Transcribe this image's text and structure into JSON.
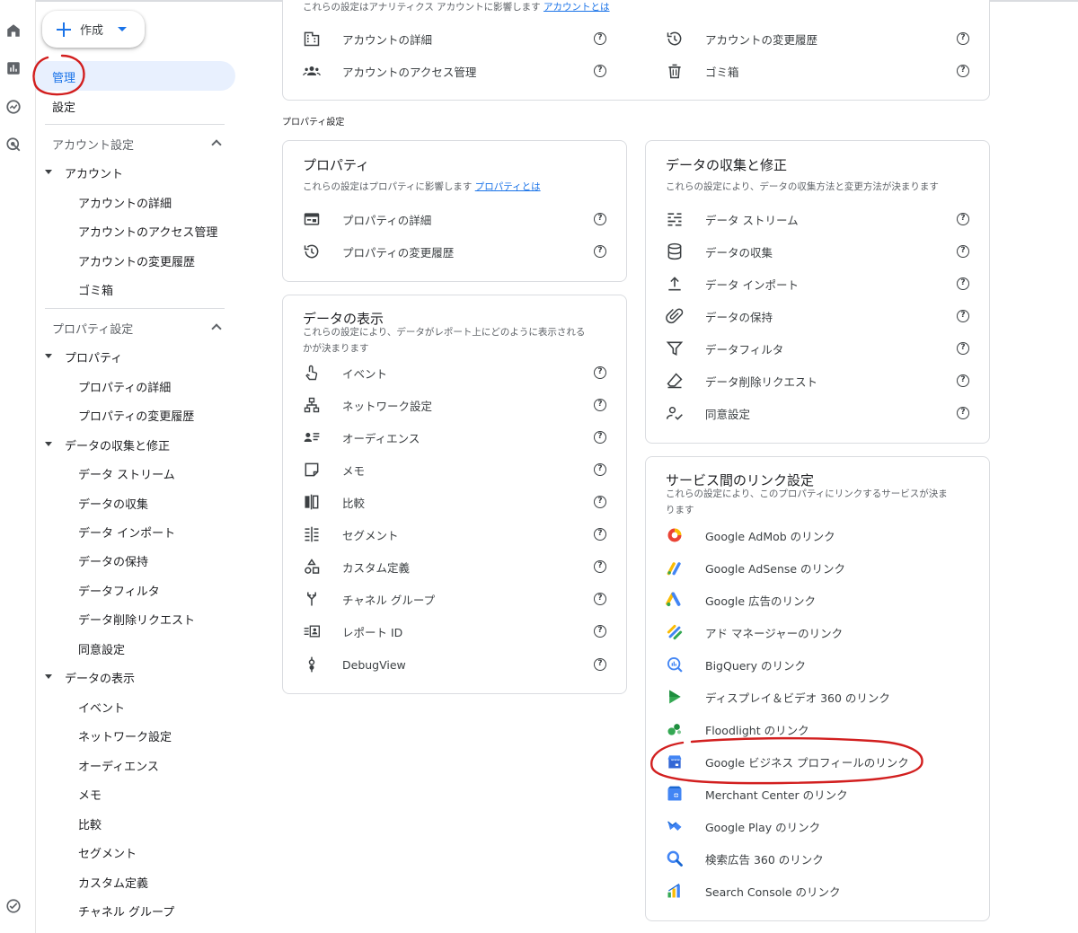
{
  "create_button": {
    "label": "作成"
  },
  "sidebar": {
    "admin_label": "管理",
    "settings_label": "設定",
    "account_section": {
      "header": "アカウント設定",
      "group": "アカウント",
      "items": [
        "アカウントの詳細",
        "アカウントのアクセス管理",
        "アカウントの変更履歴",
        "ゴミ箱"
      ]
    },
    "property_section": {
      "header": "プロパティ設定",
      "property_group": "プロパティ",
      "property_items": [
        "プロパティの詳細",
        "プロパティの変更履歴"
      ],
      "collection_group": "データの収集と修正",
      "collection_items": [
        "データ ストリーム",
        "データの収集",
        "データ インポート",
        "データの保持",
        "データフィルタ",
        "データ削除リクエスト",
        "同意設定"
      ],
      "display_group": "データの表示",
      "display_items": [
        "イベント",
        "ネットワーク設定",
        "オーディエンス",
        "メモ",
        "比較",
        "セグメント",
        "カスタム定義",
        "チャネル グループ"
      ]
    }
  },
  "account_card": {
    "desc": "これらの設定はアナリティクス アカウントに影響します",
    "desc_link": "アカウントとは",
    "left_items": [
      {
        "icon": "building-icon",
        "label": "アカウントの詳細"
      },
      {
        "icon": "people-icon",
        "label": "アカウントのアクセス管理"
      }
    ],
    "right_items": [
      {
        "icon": "history-icon",
        "label": "アカウントの変更履歴"
      },
      {
        "icon": "trash-icon",
        "label": "ゴミ箱"
      }
    ]
  },
  "property_settings_caption": "プロパティ設定",
  "property_card": {
    "title": "プロパティ",
    "desc": "これらの設定はプロパティに影響します",
    "desc_link": "プロパティとは",
    "items": [
      {
        "icon": "web-icon",
        "label": "プロパティの詳細"
      },
      {
        "icon": "history-icon",
        "label": "プロパティの変更履歴"
      }
    ]
  },
  "display_card": {
    "title": "データの表示",
    "desc_line1": "これらの設定により、データがレポート上にどのように表示される",
    "desc_line2": "かが決まります",
    "items": [
      {
        "icon": "touch-icon",
        "label": "イベント"
      },
      {
        "icon": "network-icon",
        "label": "ネットワーク設定"
      },
      {
        "icon": "audience-icon",
        "label": "オーディエンス"
      },
      {
        "icon": "note-icon",
        "label": "メモ"
      },
      {
        "icon": "compare-icon",
        "label": "比較"
      },
      {
        "icon": "segment-icon",
        "label": "セグメント"
      },
      {
        "icon": "shapes-icon",
        "label": "カスタム定義"
      },
      {
        "icon": "channel-icon",
        "label": "チャネル グループ"
      },
      {
        "icon": "report-id-icon",
        "label": "レポート ID"
      },
      {
        "icon": "debug-icon",
        "label": "DebugView"
      }
    ]
  },
  "collection_card": {
    "title": "データの収集と修正",
    "desc": "これらの設定により、データの収集方法と変更方法が決まります",
    "items": [
      {
        "icon": "stream-icon",
        "label": "データ ストリーム"
      },
      {
        "icon": "database-icon",
        "label": "データの収集"
      },
      {
        "icon": "upload-icon",
        "label": "データ インポート"
      },
      {
        "icon": "clip-icon",
        "label": "データの保持"
      },
      {
        "icon": "filter-icon",
        "label": "データフィルタ"
      },
      {
        "icon": "eraser-icon",
        "label": "データ削除リクエスト"
      },
      {
        "icon": "consent-icon",
        "label": "同意設定"
      }
    ]
  },
  "links_card": {
    "title": "サービス間のリンク設定",
    "desc_line1": "これらの設定により、このプロパティにリンクするサービスが決ま",
    "desc_line2": "ります",
    "items": [
      {
        "icon": "admob-icon",
        "label": "Google AdMob のリンク"
      },
      {
        "icon": "adsense-icon",
        "label": "Google AdSense のリンク"
      },
      {
        "icon": "google-ads-icon",
        "label": "Google 広告のリンク"
      },
      {
        "icon": "ad-manager-icon",
        "label": "アド マネージャーのリンク"
      },
      {
        "icon": "bigquery-icon",
        "label": "BigQuery のリンク"
      },
      {
        "icon": "dv360-icon",
        "label": "ディスプレイ＆ビデオ 360 のリンク"
      },
      {
        "icon": "floodlight-icon",
        "label": "Floodlight のリンク"
      },
      {
        "icon": "business-profile-icon",
        "label": "Google ビジネス プロフィールのリンク"
      },
      {
        "icon": "merchant-center-icon",
        "label": "Merchant Center のリンク"
      },
      {
        "icon": "google-play-icon",
        "label": "Google Play のリンク"
      },
      {
        "icon": "sa360-icon",
        "label": "検索広告 360 のリンク"
      },
      {
        "icon": "search-console-icon",
        "label": "Search Console のリンク"
      }
    ]
  },
  "help_glyph": "?",
  "colors": {
    "accent": "#1a73e8",
    "selected_bg": "#e8f0fe",
    "annotation": "#d21f1f"
  }
}
